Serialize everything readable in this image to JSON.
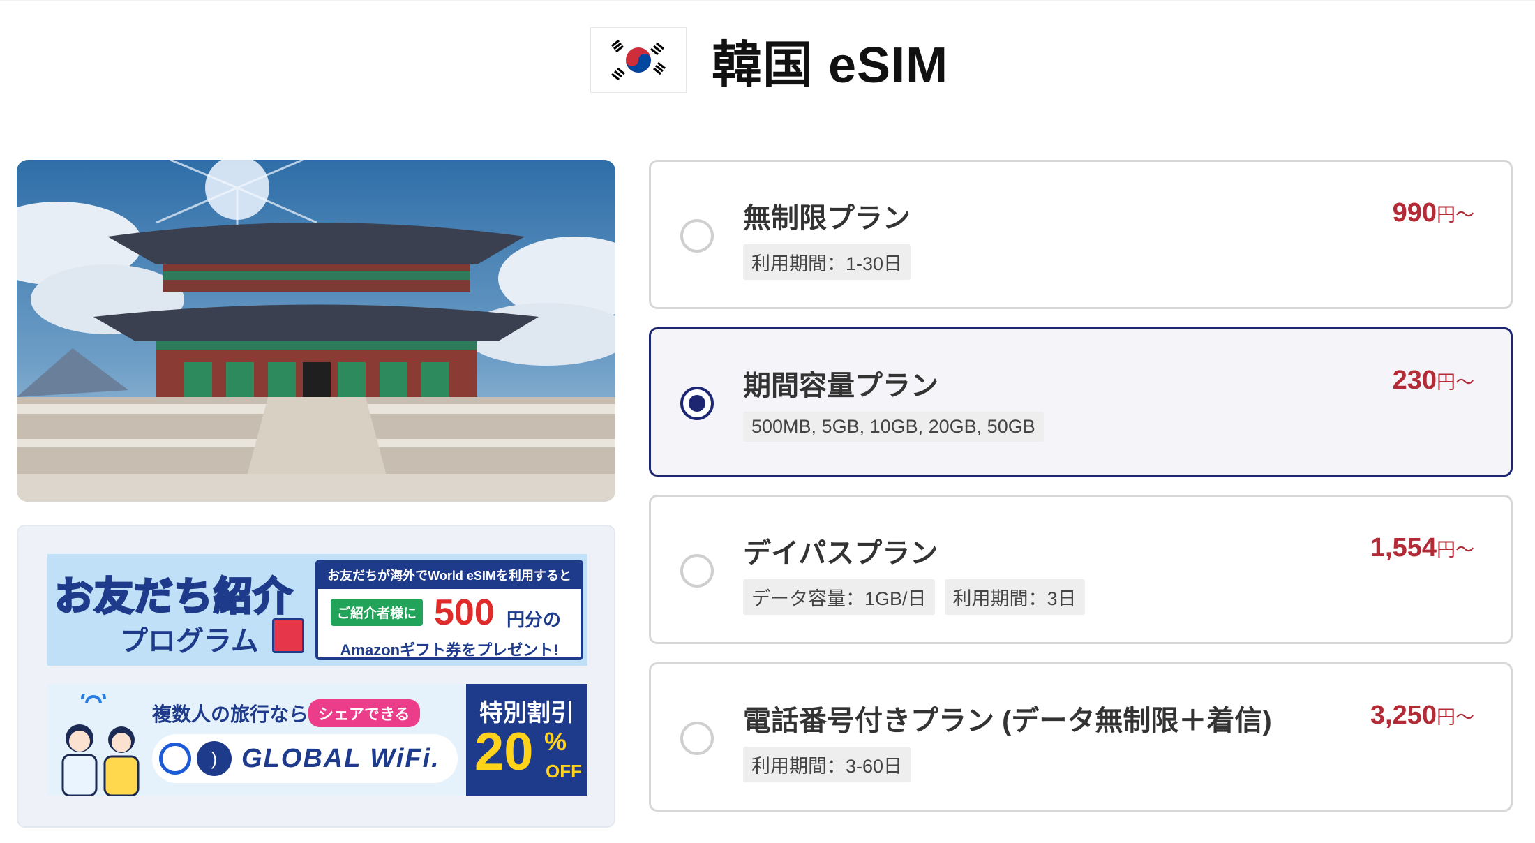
{
  "header": {
    "flag_icon": "south-korea-flag-icon",
    "title": "韓国 eSIM"
  },
  "hero_image": {
    "icon": "gyeongbokgung-palace-painting"
  },
  "banners": {
    "referral": {
      "title": "お友だち紹介",
      "subtitle": "プログラム",
      "header_text": "お友だちが海外でWorld eSIMを利用すると",
      "tag": "ご紹介者様に",
      "amount": "500",
      "amount_unit": "円分の",
      "gift_text": "Amazonギフト券をプレゼント!"
    },
    "global_wifi": {
      "text": "複数人の旅行なら!",
      "pill": "シェアできる",
      "logo_text": "GLOBAL WiFi.",
      "promo_title": "特別割引",
      "promo_value": "20",
      "promo_percent": "%",
      "promo_off": "OFF"
    }
  },
  "plans": [
    {
      "name": "無制限プラン",
      "tags": [
        "利用期間：1-30日"
      ],
      "price": "990",
      "price_unit": "円〜",
      "selected": false
    },
    {
      "name": "期間容量プラン",
      "tags": [
        "500MB, 5GB, 10GB, 20GB, 50GB"
      ],
      "price": "230",
      "price_unit": "円〜",
      "selected": true
    },
    {
      "name": "デイパスプラン",
      "tags": [
        "データ容量：1GB/日",
        "利用期間：3日"
      ],
      "price": "1,554",
      "price_unit": "円〜",
      "selected": false
    },
    {
      "name": "電話番号付きプラン (データ無制限＋着信)",
      "tags": [
        "利用期間：3-60日"
      ],
      "price": "3,250",
      "price_unit": "円〜",
      "selected": false
    }
  ],
  "colors": {
    "accent": "#1d2671",
    "price": "#b32b36"
  }
}
